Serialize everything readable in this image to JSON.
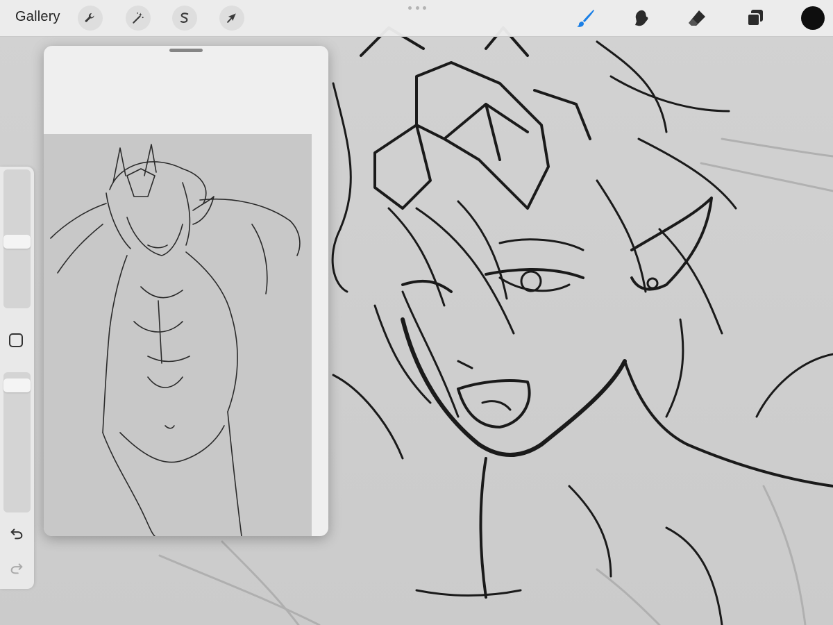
{
  "toolbar": {
    "gallery_label": "Gallery",
    "left_tools": [
      {
        "name": "actions",
        "icon": "wrench-icon"
      },
      {
        "name": "adjustments",
        "icon": "magic-wand-icon"
      },
      {
        "name": "selection",
        "icon": "selection-s-icon"
      },
      {
        "name": "transform",
        "icon": "arrow-cursor-icon"
      }
    ],
    "right_tools": [
      {
        "name": "brush",
        "icon": "brush-icon",
        "active": true
      },
      {
        "name": "smudge",
        "icon": "smudge-icon",
        "active": false
      },
      {
        "name": "eraser",
        "icon": "eraser-icon",
        "active": false
      },
      {
        "name": "layers",
        "icon": "layers-icon",
        "active": false
      }
    ],
    "current_color": "#0e0e0e",
    "accent_color": "#1a7fe6"
  },
  "sidebar": {
    "brush_size_level": 0.48,
    "opacity_level": 0.95,
    "modify_icon": "square-icon",
    "undo_icon": "undo-icon",
    "redo_icon": "redo-icon"
  },
  "reference_panel": {
    "grabber_icon": "panel-grabber-icon"
  }
}
